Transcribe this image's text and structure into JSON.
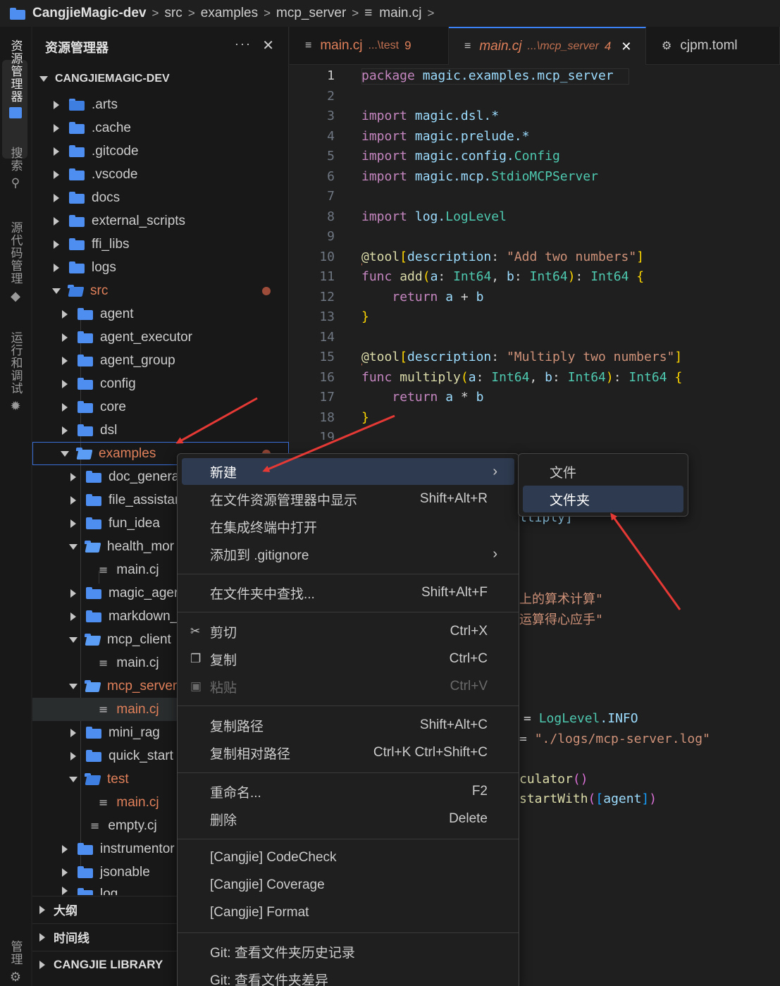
{
  "breadcrumb": [
    "CangjieMagic-dev",
    "src",
    "examples",
    "mcp_server",
    "main.cj"
  ],
  "activity": {
    "explorer": "资源管理器",
    "search": "搜索",
    "scm": "源代码管理",
    "debug": "运行和调试",
    "manage": "管理"
  },
  "sidebar": {
    "title": "资源管理器",
    "more": "···",
    "close": "✕",
    "root": "CANGJIEMAGIC-DEV",
    "items": [
      {
        "label": ".arts"
      },
      {
        "label": ".cache"
      },
      {
        "label": ".gitcode"
      },
      {
        "label": ".vscode"
      },
      {
        "label": "docs"
      },
      {
        "label": "external_scripts"
      },
      {
        "label": "ffi_libs"
      },
      {
        "label": "logs"
      },
      {
        "label": "src"
      },
      {
        "label": "agent"
      },
      {
        "label": "agent_executor"
      },
      {
        "label": "agent_group"
      },
      {
        "label": "config"
      },
      {
        "label": "core"
      },
      {
        "label": "dsl"
      },
      {
        "label": "examples"
      },
      {
        "label": "doc_genera"
      },
      {
        "label": "file_assistar"
      },
      {
        "label": "fun_idea"
      },
      {
        "label": "health_mor"
      },
      {
        "label": "main.cj"
      },
      {
        "label": "magic_ager"
      },
      {
        "label": "markdown_"
      },
      {
        "label": "mcp_client"
      },
      {
        "label": "main.cj"
      },
      {
        "label": "mcp_server"
      },
      {
        "label": "main.cj"
      },
      {
        "label": "mini_rag"
      },
      {
        "label": "quick_start"
      },
      {
        "label": "test"
      },
      {
        "label": "main.cj"
      },
      {
        "label": "empty.cj"
      },
      {
        "label": "instrumentor"
      },
      {
        "label": "jsonable"
      },
      {
        "label": "log"
      }
    ],
    "panels": [
      "大纲",
      "时间线",
      "CANGJIE LIBRARY"
    ]
  },
  "tabs": [
    {
      "name": "main.cj",
      "path": "...\\test",
      "badge": "9"
    },
    {
      "name": "main.cj",
      "path": "...\\mcp_server",
      "badge": "4",
      "close": "✕"
    },
    {
      "name": "cjpm.toml"
    }
  ],
  "editor": {
    "line_numbers": [
      "1",
      "2",
      "3",
      "4",
      "5",
      "6",
      "7",
      "8",
      "9",
      "10",
      "11",
      "12",
      "13",
      "14",
      "15",
      "16",
      "17",
      "18",
      "19"
    ],
    "fragments": {
      "package_kw": "package",
      "package_name": "magic.examples.mcp_server",
      "import_kw": "import",
      "import1": "magic.dsl.*",
      "import2": "magic.prelude.*",
      "import3_pkg": "magic.config.",
      "import3_cls": "Config",
      "import4_pkg": "magic.mcp.",
      "import4_cls": "StdioMCPServer",
      "import5_pkg": "log.",
      "import5_cls": "LogLevel",
      "at": "@",
      "tool": "tool",
      "description": "description",
      "desc1": "\"Add two numbers\"",
      "desc2": "\"Multiply two numbers\"",
      "func_kw": "func",
      "fn_add": "add",
      "fn_mul": "multiply",
      "param_a": "a",
      "param_b": "b",
      "int64": "Int64",
      "return_kw": "return",
      "plus": "+",
      "times": "*",
      "peek1": "ltiply]",
      "peek2": "上的算术计算\"",
      "peek3": "运算得心应手\"",
      "peek4_eq": "= ",
      "peek4_cls": "LogLevel",
      "peek4_val": ".INFO",
      "peek5_eq": "= ",
      "peek5_str": "\"./logs/mcp-server.log\"",
      "peek6": "culator",
      "peek7_fn": "startWith",
      "peek7_arg": "agent"
    }
  },
  "context_menu": {
    "items": [
      {
        "label": "新建"
      },
      {
        "label": "在文件资源管理器中显示",
        "key": "Shift+Alt+R"
      },
      {
        "label": "在集成终端中打开"
      },
      {
        "label": "添加到 .gitignore"
      },
      {
        "label": "在文件夹中查找...",
        "key": "Shift+Alt+F"
      },
      {
        "label": "剪切",
        "key": "Ctrl+X"
      },
      {
        "label": "复制",
        "key": "Ctrl+C"
      },
      {
        "label": "粘贴",
        "key": "Ctrl+V"
      },
      {
        "label": "复制路径",
        "key": "Shift+Alt+C"
      },
      {
        "label": "复制相对路径",
        "key": "Ctrl+K Ctrl+Shift+C"
      },
      {
        "label": "重命名...",
        "key": "F2"
      },
      {
        "label": "删除",
        "key": "Delete"
      },
      {
        "label": "[Cangjie] CodeCheck"
      },
      {
        "label": "[Cangjie] Coverage"
      },
      {
        "label": "[Cangjie] Format"
      },
      {
        "label": "Git: 查看文件夹历史记录"
      },
      {
        "label": "Git: 查看文件夹差异"
      }
    ],
    "chevron": "›"
  },
  "submenu": {
    "items": [
      {
        "label": "文件"
      },
      {
        "label": "文件夹"
      }
    ]
  },
  "colors": {
    "accent": "#3b82f6",
    "folder": "#4d8ef0",
    "modified": "#e0805a",
    "arrow": "#e53935"
  }
}
